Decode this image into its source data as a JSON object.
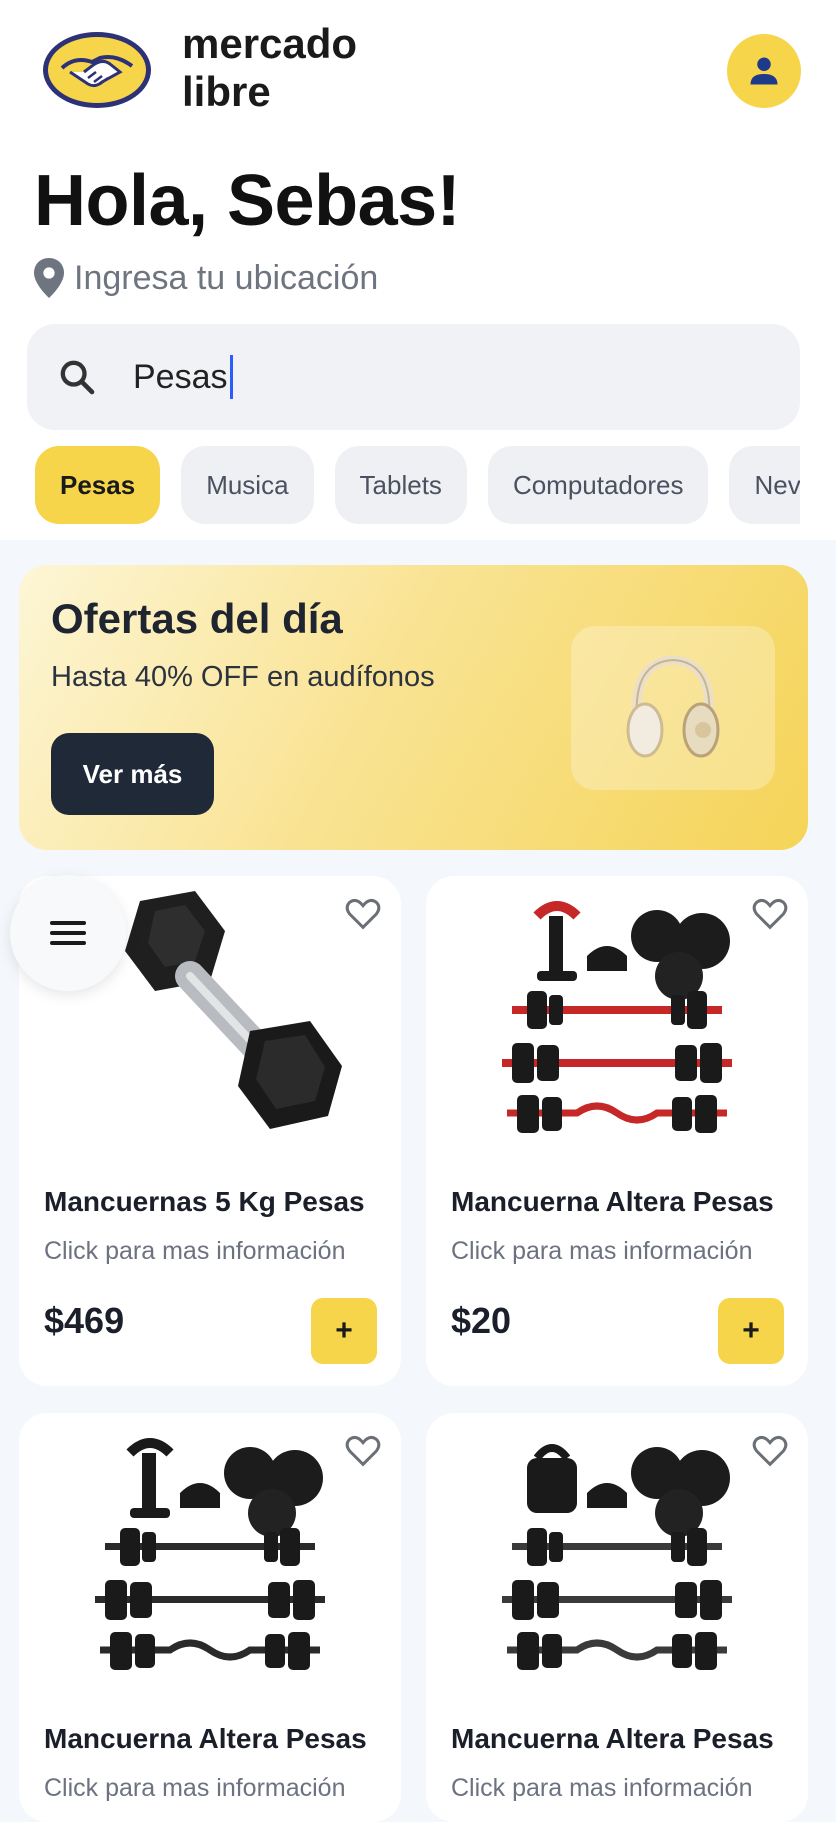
{
  "header": {
    "logo_line1": "mercado",
    "logo_line2": "libre",
    "logo_icon": "handshake-logo",
    "avatar_icon": "user-icon"
  },
  "greeting": "Hola, Sebas!",
  "location": {
    "icon": "location-pin-icon",
    "label": "Ingresa tu ubicación"
  },
  "search": {
    "icon": "search-icon",
    "value": "Pesas"
  },
  "chips": [
    {
      "label": "Pesas",
      "active": true
    },
    {
      "label": "Musica",
      "active": false
    },
    {
      "label": "Tablets",
      "active": false
    },
    {
      "label": "Computadores",
      "active": false
    },
    {
      "label": "Neve",
      "active": false
    }
  ],
  "promo": {
    "title": "Ofertas del día",
    "subtitle": "Hasta 40% OFF en audífonos",
    "button": "Ver más",
    "image": "headphones-image"
  },
  "products": [
    {
      "title": "Mancuernas 5 Kg Pesas",
      "desc": "Click para mas información",
      "price": "$469",
      "add": "+",
      "image": "dumbbell-image"
    },
    {
      "title": "Mancuerna Altera Pesas",
      "desc": "Click para mas información",
      "price": "$20",
      "add": "+",
      "image": "weights-set-image"
    },
    {
      "title": "Mancuerna Altera Pesas",
      "desc": "Click para mas información",
      "price": "",
      "add": "+",
      "image": "weights-set-image"
    },
    {
      "title": "Mancuerna Altera Pesas",
      "desc": "Click para mas información",
      "price": "",
      "add": "+",
      "image": "weights-set-image"
    }
  ],
  "colors": {
    "brand_yellow": "#f7d54a",
    "dark_button": "#1f2937",
    "feed_bg": "#f4f7fb"
  }
}
